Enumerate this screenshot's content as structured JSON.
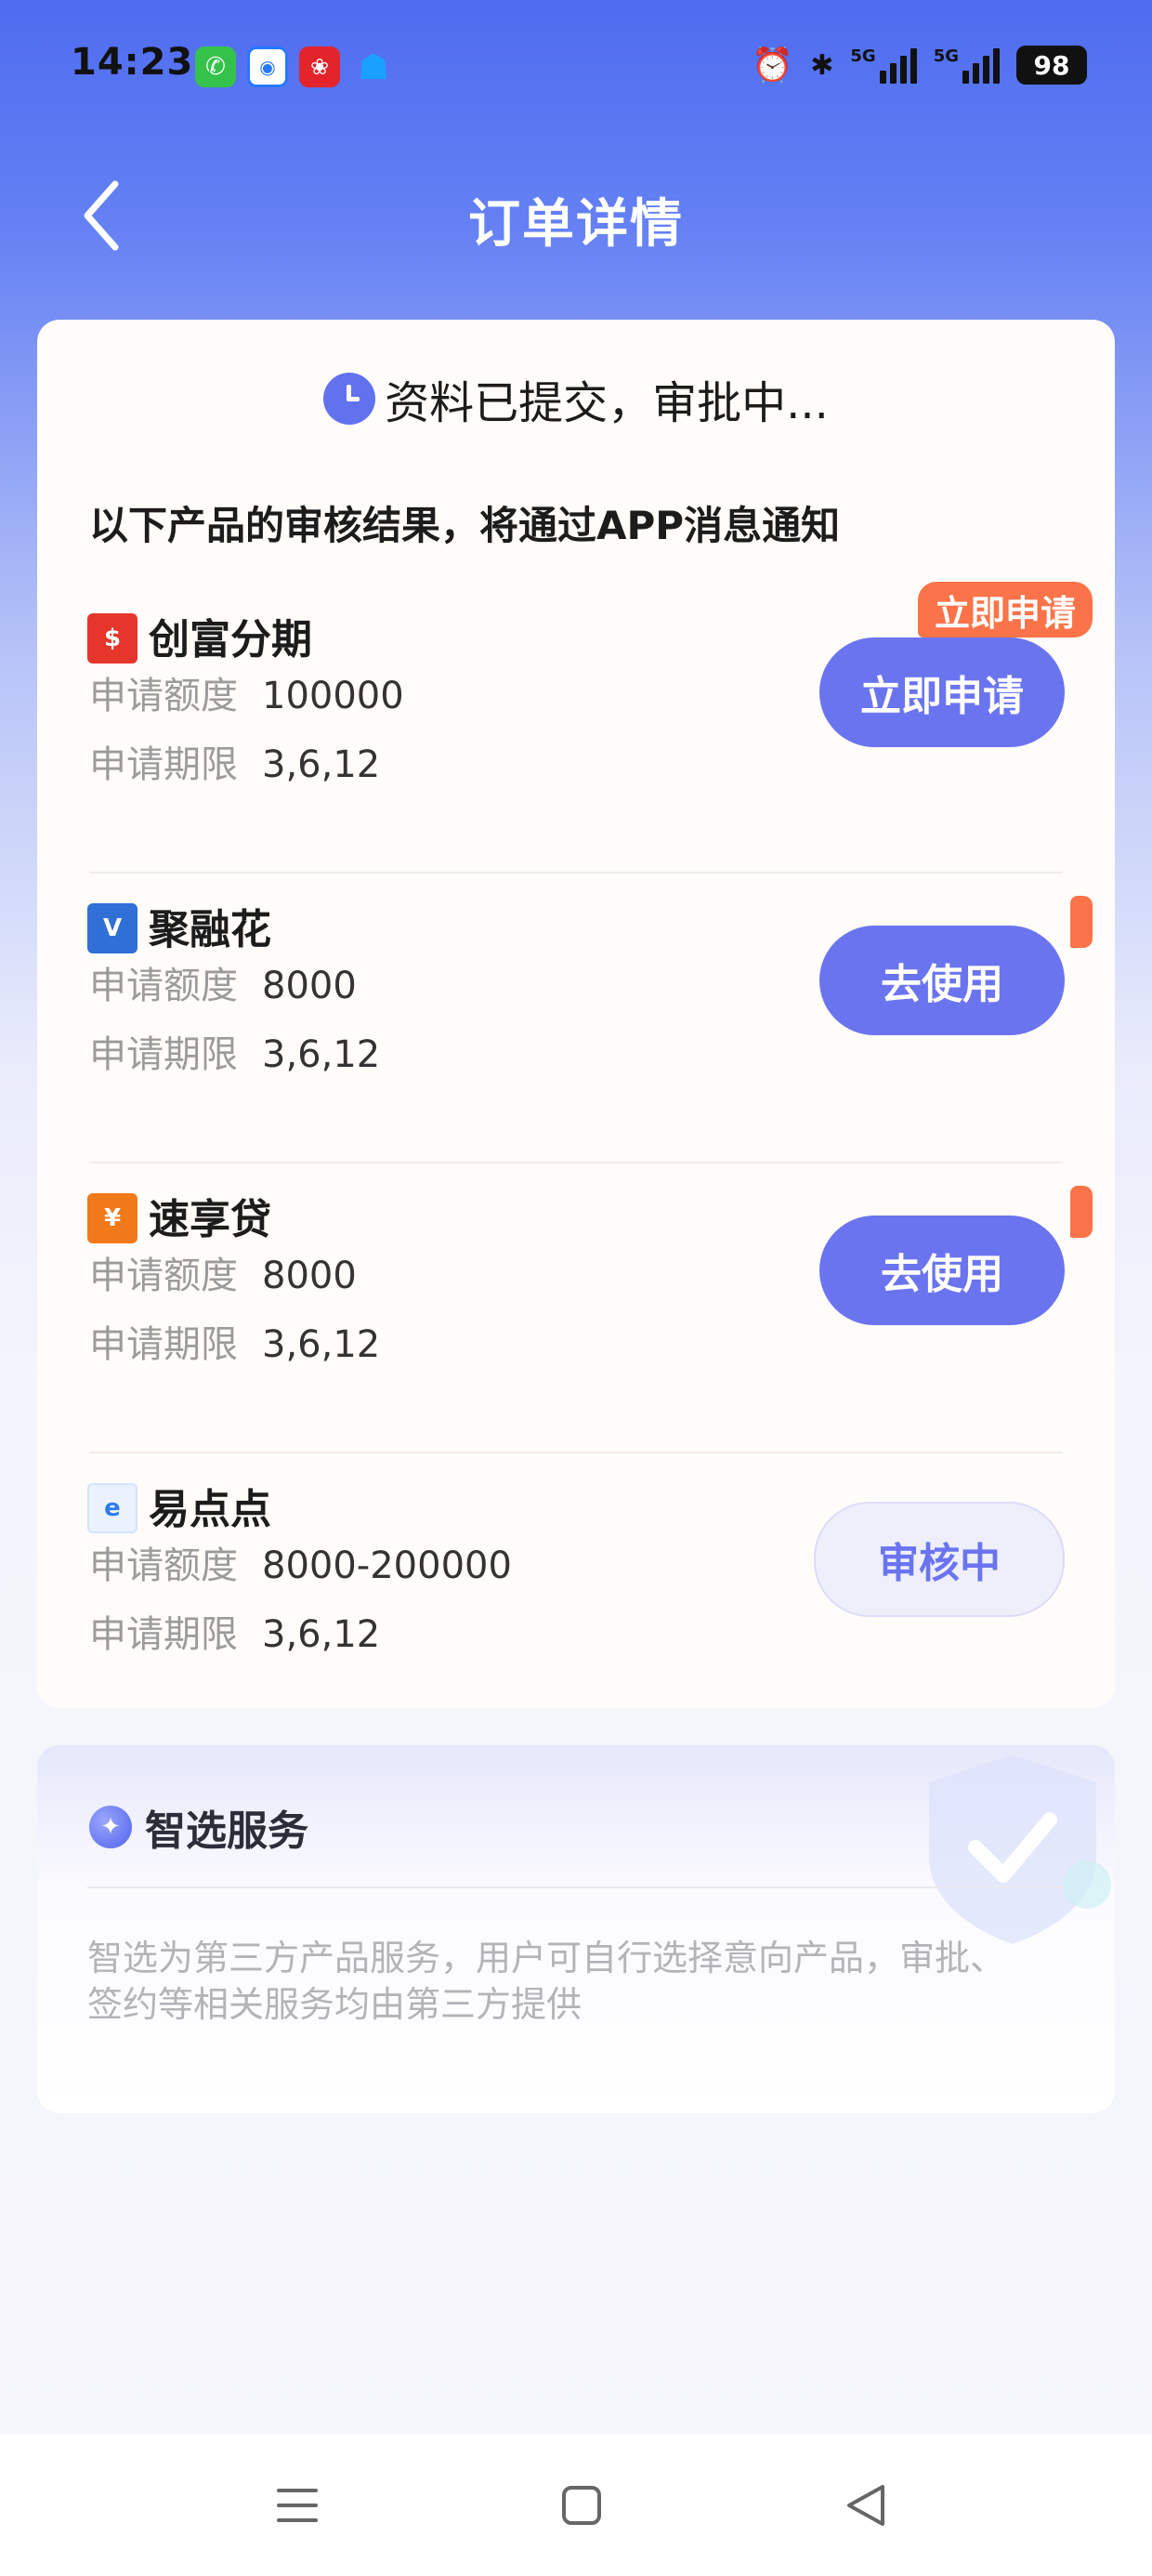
{
  "status_bar": {
    "time": "14:23",
    "app_icons": [
      "phone-icon",
      "bank-app-icon",
      "pinduoduo-icon",
      "qq-icon"
    ],
    "network_1": "5G",
    "network_2": "5G",
    "battery": "98"
  },
  "nav": {
    "title": "订单详情"
  },
  "order": {
    "status": "资料已提交，审批中...",
    "notice": "以下产品的审核结果，将通过APP消息通知",
    "amount_label": "申请额度",
    "term_label": "申请期限",
    "products": [
      {
        "name": "创富分期",
        "amount": "100000",
        "term": "3,6,12",
        "button": "立即申请",
        "badge": "立即申请",
        "logo_color": "#e6352b"
      },
      {
        "name": "聚融花",
        "amount": "8000",
        "term": "3,6,12",
        "button": "去使用",
        "logo_color": "#2f6fd6"
      },
      {
        "name": "速享贷",
        "amount": "8000",
        "term": "3,6,12",
        "button": "去使用",
        "logo_color": "#f07a1a"
      },
      {
        "name": "易点点",
        "amount": "8000-200000",
        "term": "3,6,12",
        "button": "审核中",
        "logo_color": "#2f7be8"
      }
    ]
  },
  "service": {
    "title": "智选服务",
    "description": "智选为第三方产品服务，用户可自行选择意向产品，审批、签约等相关服务均由第三方提供"
  },
  "colors": {
    "accent": "#6b74ef",
    "badge": "#fb7349",
    "header": "#4f6cf0"
  }
}
